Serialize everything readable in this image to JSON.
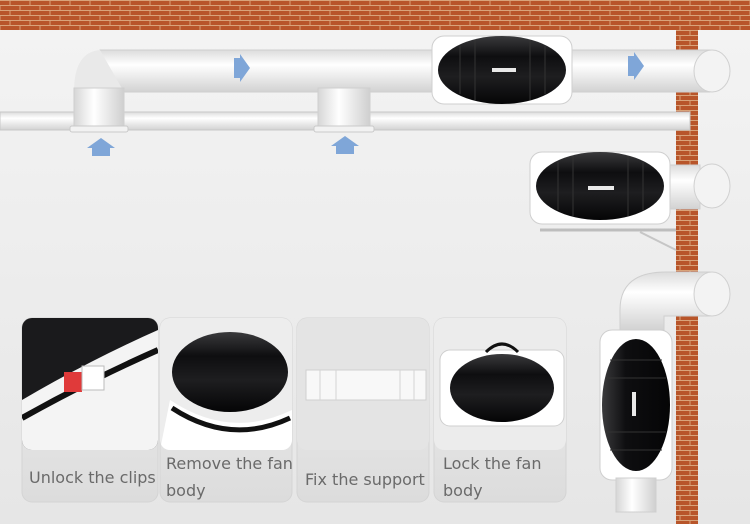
{
  "captions": {
    "step1": "Unlock the clips",
    "step2_line1": "Remove the fan",
    "step2_line2": "body",
    "step3": "Fix the support",
    "step4_line1": "Lock the fan",
    "step4_line2": "body"
  },
  "colors": {
    "brick": "#b8552a",
    "mortar": "#d9a37a",
    "wall_bg": "#f2f2f2",
    "duct": "#f7f7f7",
    "fan_body": "#1c1c1e",
    "arrow": "#7fa6d8"
  }
}
